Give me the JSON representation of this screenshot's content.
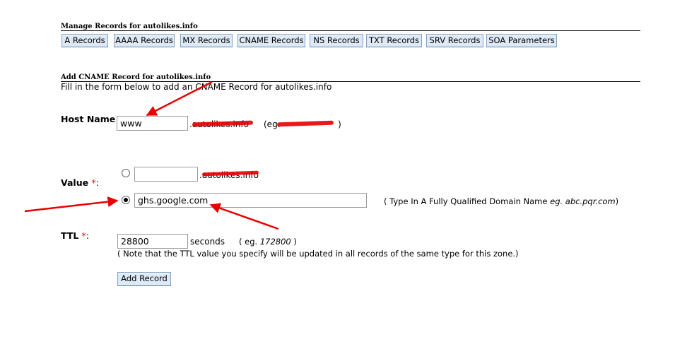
{
  "manage_title": "Manage Records for autolikes.info",
  "tabs": [
    "A Records",
    "AAAA Records",
    "MX Records",
    "CNAME Records",
    "NS Records",
    "TXT Records",
    "SRV Records",
    "SOA Parameters"
  ],
  "add_title": "Add CNAME Record for autolikes.info",
  "instructions": "Fill in the form below to add an CNAME Record for autolikes.info",
  "host": {
    "label": "Host Name",
    "colon": ":",
    "value": "www",
    "suffix": ".autolikes.info",
    "example_open": "(eg.",
    "example_close": ")"
  },
  "value": {
    "label": "Value",
    "required": "*",
    "colon": ":",
    "option1_value": "",
    "option1_suffix": ".autolikes.info",
    "option2_value": "ghs.google.com",
    "hint_prefix": "( Type In A Fully Qualified Domain Name ",
    "hint_example": "eg. abc.pqr.com",
    "hint_suffix": ")"
  },
  "ttl": {
    "label": "TTL",
    "required": "*",
    "colon": ":",
    "value": "28800",
    "unit": "seconds",
    "example_prefix": "( eg. ",
    "example_value": "172800",
    "example_suffix": " )",
    "note": "( Note that the TTL value you specify will be updated in all records of the same type for this zone.)"
  },
  "submit_label": "Add Record",
  "annotation_color": "#e80000"
}
